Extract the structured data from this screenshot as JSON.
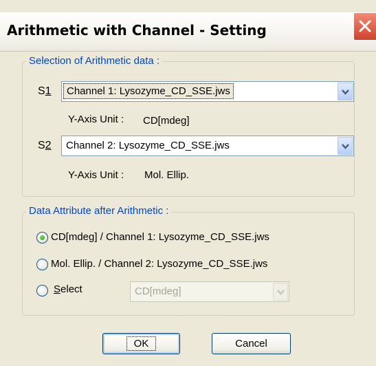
{
  "window": {
    "title": "Arithmetic with Channel - Setting"
  },
  "selection_group": {
    "legend": "Selection of Arithmetic data :",
    "s1": {
      "label": "S1",
      "value": "Channel 1: Lysozyme_CD_SSE.jws",
      "unit_label": "Y-Axis Unit :",
      "unit_value": "CD[mdeg]"
    },
    "s2": {
      "label": "S2",
      "value": "Channel 2: Lysozyme_CD_SSE.jws",
      "unit_label": "Y-Axis Unit :",
      "unit_value": "Mol. Ellip."
    }
  },
  "attribute_group": {
    "legend": "Data Attribute after Arithmetic :",
    "options": [
      {
        "label": "CD[mdeg] / Channel 1: Lysozyme_CD_SSE.jws",
        "selected": true
      },
      {
        "label": "Mol. Ellip. / Channel 2: Lysozyme_CD_SSE.jws",
        "selected": false
      },
      {
        "label": "Select",
        "selected": false
      }
    ],
    "select_value": "CD[mdeg]"
  },
  "buttons": {
    "ok": "OK",
    "cancel": "Cancel"
  },
  "colors": {
    "legend_text": "#0046d5",
    "close_button": "#d0432a",
    "dialog_bg": "#ece9d8"
  }
}
